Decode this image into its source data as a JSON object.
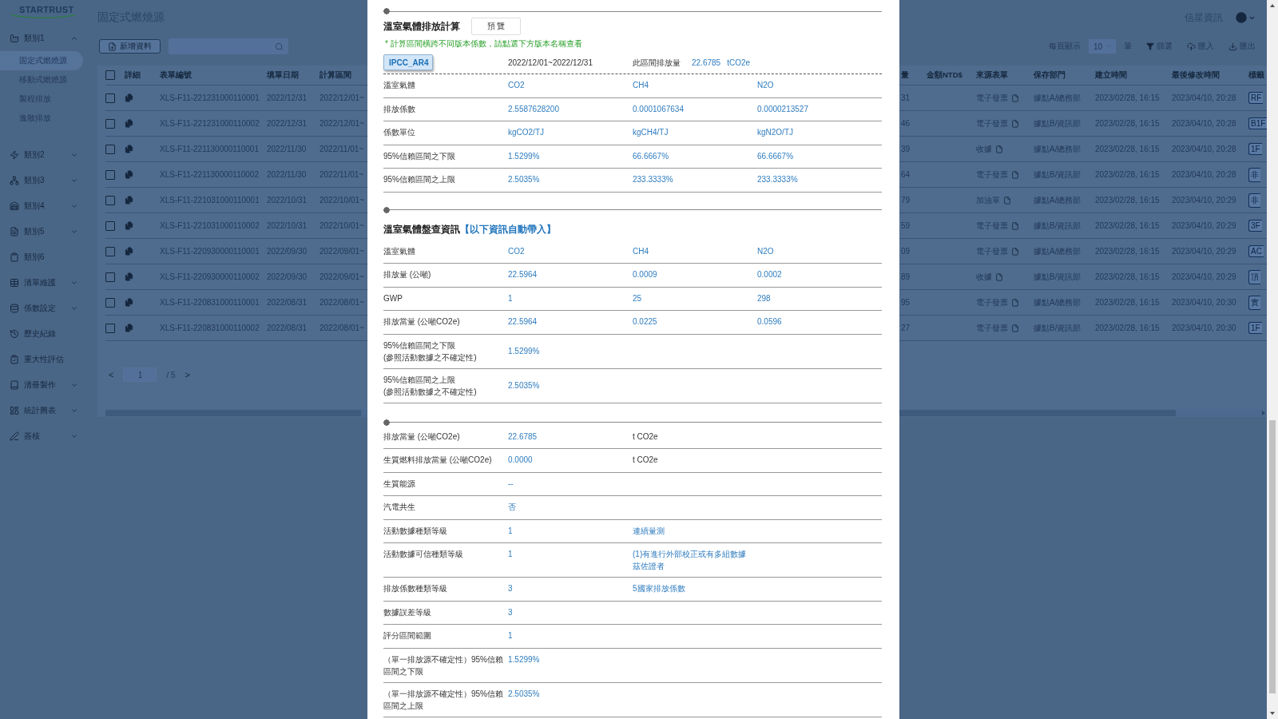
{
  "app": {
    "logo": "STARTRUST",
    "page_title": "固定式燃燒源",
    "company": "信星資訊",
    "add_button": "新增資料",
    "page_size_label": "每頁顯示",
    "page_size": "10",
    "page_size_unit": "筆",
    "filter": "篩選",
    "import": "匯入",
    "export": "匯出"
  },
  "sidebar": {
    "items": [
      {
        "label": "類別1",
        "kind": "group",
        "expanded": true,
        "children": [
          {
            "label": "固定式燃燒源",
            "selected": true
          },
          {
            "label": "移動式燃燒源",
            "selected": false
          },
          {
            "label": "製程排放",
            "selected": false
          },
          {
            "label": "逸散排放",
            "selected": false
          }
        ]
      },
      {
        "label": "類別2",
        "kind": "group",
        "expanded": false
      },
      {
        "label": "類別3",
        "kind": "group",
        "expanded": false
      },
      {
        "label": "類別4",
        "kind": "group",
        "expanded": false
      },
      {
        "label": "類別5",
        "kind": "group",
        "expanded": false
      },
      {
        "label": "類別6",
        "kind": "link"
      },
      {
        "label": "清單維護",
        "kind": "group",
        "expanded": false
      },
      {
        "label": "係數設定",
        "kind": "group",
        "expanded": false
      },
      {
        "label": "歷史紀錄",
        "kind": "link"
      },
      {
        "label": "重大性評估",
        "kind": "link"
      },
      {
        "label": "清冊製作",
        "kind": "group",
        "expanded": false
      },
      {
        "label": "統計圖表",
        "kind": "group",
        "expanded": false
      },
      {
        "label": "簽核",
        "kind": "group",
        "expanded": false
      }
    ]
  },
  "table": {
    "select_all_checked": false,
    "columns": [
      "詳細",
      "表單編號",
      "填單日期",
      "計算區間",
      "量",
      "金額NTD$",
      "來源表單",
      "保存部門",
      "建立時間",
      "最後修改時間",
      "標籤"
    ],
    "rows": [
      {
        "checked": false,
        "form_no": "XLS-F11-221231000110001",
        "date": "2022/12/31",
        "period": "2022/12/01~",
        "amount": "31",
        "source": "電子發票",
        "dept": "據點A/總務部",
        "created": "2023/02/28, 16:15",
        "modified": "2023/04/10, 20:28",
        "tag": "RF"
      },
      {
        "checked": false,
        "form_no": "XLS-F11-221231000110002",
        "date": "2022/12/31",
        "period": "2022/12/01~",
        "amount": "46",
        "source": "電子發票",
        "dept": "據點B/資訊部",
        "created": "2023/02/28, 16:15",
        "modified": "2023/04/10, 20:28",
        "tag": "B1F"
      },
      {
        "checked": false,
        "form_no": "XLS-F11-221130000110001",
        "date": "2022/11/30",
        "period": "2022/11/01~",
        "amount": "39",
        "source": "收據",
        "dept": "據點A/總務部",
        "created": "2023/02/28, 16:15",
        "modified": "2023/04/10, 20:28",
        "tag": "1F"
      },
      {
        "checked": false,
        "form_no": "XLS-F11-221130000110002",
        "date": "2022/11/30",
        "period": "2022/11/01~",
        "amount": "64",
        "source": "電子發票",
        "dept": "據點B/資訊部",
        "created": "2023/02/28, 16:15",
        "modified": "2023/04/10, 20:28",
        "tag": "非"
      },
      {
        "checked": false,
        "form_no": "XLS-F11-221031000110001",
        "date": "2022/10/31",
        "period": "2022/10/01~",
        "amount": "79",
        "source": "加油單",
        "dept": "據點A/總務部",
        "created": "2023/02/28, 16:15",
        "modified": "2023/04/10, 20:29",
        "tag": "非"
      },
      {
        "checked": false,
        "form_no": "XLS-F11-221031000110002",
        "date": "2022/10/31",
        "period": "2022/10/01~",
        "amount": "59",
        "source": "電子發票",
        "dept": "據點B/資訊部",
        "created": "2023/02/28, 16:15",
        "modified": "2023/04/10, 20:29",
        "tag": "3F"
      },
      {
        "checked": false,
        "form_no": "XLS-F11-220930000110001",
        "date": "2022/09/30",
        "period": "2022/09/01~",
        "amount": "09",
        "source": "電子發票",
        "dept": "據點A/總務部",
        "created": "2023/02/28, 16:15",
        "modified": "2023/04/10, 20:29",
        "tag": "AC"
      },
      {
        "checked": false,
        "form_no": "XLS-F11-220930000110002",
        "date": "2022/09/30",
        "period": "2022/09/01~",
        "amount": "89",
        "source": "收據",
        "dept": "據點B/資訊部",
        "created": "2023/02/28, 16:15",
        "modified": "2023/04/10, 20:29",
        "tag": "頂"
      },
      {
        "checked": false,
        "form_no": "XLS-F11-220831000110001",
        "date": "2022/08/31",
        "period": "2022/08/01~",
        "amount": "95",
        "source": "電子發票",
        "dept": "據點A/總務部",
        "created": "2023/02/28, 16:15",
        "modified": "2023/04/10, 20:30",
        "tag": "實"
      },
      {
        "checked": false,
        "form_no": "XLS-F11-220831000110002",
        "date": "2022/08/31",
        "period": "2022/08/01~",
        "amount": "27",
        "source": "電子發票",
        "dept": "據點B/資訊部",
        "created": "2023/02/28, 16:15",
        "modified": "2023/04/10, 20:30",
        "tag": "1F"
      }
    ]
  },
  "pagination": {
    "page": "1",
    "total": "/ 5",
    "prev": "<",
    "next": ">"
  },
  "modal": {
    "calc": {
      "title": "溫室氣體排放計算",
      "preview_button": "預 覽",
      "note": "* 計算區間橫跨不同版本係數，請點選下方版本名稱查看",
      "versions": [
        {
          "label": "IPCC_AR4",
          "selected": true
        }
      ],
      "period": "2022/12/01~2022/12/31",
      "interval_label": "此區間排放量",
      "interval_value": "22.6785",
      "interval_unit": "tCO2e",
      "rows": [
        {
          "label": "溫室氣體",
          "values": [
            "CO2",
            "CH4",
            "N2O"
          ]
        },
        {
          "label": "排放係數",
          "values": [
            "2.5587628200",
            "0.0001067634",
            "0.0000213527"
          ]
        },
        {
          "label": "係數單位",
          "values": [
            "kgCO2/TJ",
            "kgCH4/TJ",
            "kgN2O/TJ"
          ]
        },
        {
          "label": "95%信賴區間之下限",
          "values": [
            "1.5299%",
            "66.6667%",
            "66.6667%"
          ]
        },
        {
          "label": "95%信賴區間之上限",
          "values": [
            "2.5035%",
            "233.3333%",
            "233.3333%"
          ]
        }
      ]
    },
    "inventory": {
      "title": "溫室氣體盤查資訊",
      "title_note": "【以下資訊自動帶入】",
      "rows": [
        {
          "label": "溫室氣體",
          "values": [
            "CO2",
            "CH4",
            "N2O"
          ]
        },
        {
          "label": "排放量 (公噸)",
          "values": [
            "22.5964",
            "0.0009",
            "0.0002"
          ]
        },
        {
          "label": "GWP",
          "values": [
            "1",
            "25",
            "298"
          ]
        },
        {
          "label": "排放當量 (公噸CO2e)",
          "values": [
            "22.5964",
            "0.0225",
            "0.0596"
          ]
        },
        {
          "label": "95%信賴區間之下限\n(參照活動數據之不確定性)",
          "values": [
            "1.5299%"
          ]
        },
        {
          "label": "95%信賴區間之上限\n(參照活動數據之不確定性)",
          "values": [
            "2.5035%"
          ]
        }
      ]
    },
    "summary": {
      "rows": [
        {
          "label": "排放當量 (公噸CO2e)",
          "value": "22.6785",
          "unit": "t CO2e"
        },
        {
          "label": "生質燃料排放當量 (公噸CO2e)",
          "value": "0.0000",
          "unit": "t CO2e"
        },
        {
          "label": "生質能源",
          "value": "--"
        },
        {
          "label": "汽電共生",
          "value": "否"
        },
        {
          "label": "活動數據種類等級",
          "value": "1",
          "note": "連續量測"
        },
        {
          "label": "活動數據可信種類等級",
          "value": "1",
          "note": "(1)有進行外部校正或有多組數據茲佐證者"
        },
        {
          "label": "排放係數種類等級",
          "value": "3",
          "note": "5國家排放係數"
        },
        {
          "label": "數據誤差等級",
          "value": "3"
        },
        {
          "label": "評分區間範圍",
          "value": "1"
        },
        {
          "label": "（單一排放源不確定性）95%信賴區間之下限",
          "value": "1.5299%"
        },
        {
          "label": "（單一排放源不確定性）95%信賴區間之上限",
          "value": "2.5035%"
        }
      ]
    }
  }
}
